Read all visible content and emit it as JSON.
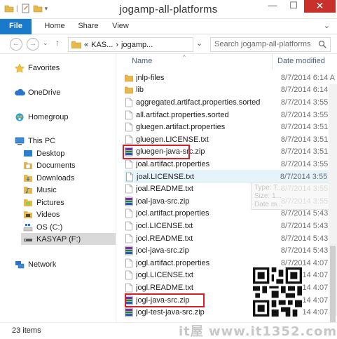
{
  "window": {
    "title": "jogamp-all-platforms",
    "minimize": "—",
    "maximize": "☐",
    "close": "✕"
  },
  "ribbon": {
    "tabs": [
      "File",
      "Home",
      "Share",
      "View"
    ],
    "expand": "⌄"
  },
  "address": {
    "back": "←",
    "forward": "→",
    "recent": "⌄",
    "up": "↑",
    "overflow": "«",
    "crumbs": [
      "KAS...",
      "jogamp..."
    ],
    "separator": "›",
    "search_placeholder": "Search jogamp-all-platforms"
  },
  "nav": {
    "favorites": "Favorites",
    "onedrive": "OneDrive",
    "homegroup": "Homegroup",
    "thispc": "This PC",
    "desktop": "Desktop",
    "documents": "Documents",
    "downloads": "Downloads",
    "music": "Music",
    "pictures": "Pictures",
    "videos": "Videos",
    "osc": "OS (C:)",
    "kasyap": "KASYAP (F:)",
    "network": "Network"
  },
  "columns": {
    "name": "Name",
    "date": "Date modified"
  },
  "files": [
    {
      "name": "jnlp-files",
      "date": "8/7/2014 6:14 A",
      "type": "folder"
    },
    {
      "name": "lib",
      "date": "8/7/2014 6:14 A",
      "type": "folder"
    },
    {
      "name": "aggregated.artifact.properties.sorted",
      "date": "8/7/2014 3:55 A",
      "type": "file"
    },
    {
      "name": "all.artifact.properties.sorted",
      "date": "8/7/2014 3:55 A",
      "type": "file"
    },
    {
      "name": "gluegen.artifact.properties",
      "date": "8/7/2014 3:51 A",
      "type": "file"
    },
    {
      "name": "gluegen.LICENSE.txt",
      "date": "8/7/2014 3:51 A",
      "type": "file"
    },
    {
      "name": "gluegen-java-src.zip",
      "date": "8/7/2014 3:51 A",
      "type": "zip"
    },
    {
      "name": "joal.artifact.properties",
      "date": "8/7/2014 3:55 A",
      "type": "file"
    },
    {
      "name": "joal.LICENSE.txt",
      "date": "8/7/2014 3:55 A",
      "type": "file"
    },
    {
      "name": "joal.README.txt",
      "date": "8/7/2014 3:55 A",
      "type": "file"
    },
    {
      "name": "joal-java-src.zip",
      "date": "8/7/2014 3:55 A",
      "type": "zip"
    },
    {
      "name": "jocl.artifact.properties",
      "date": "8/7/2014 5:43 A",
      "type": "file"
    },
    {
      "name": "jocl.LICENSE.txt",
      "date": "8/7/2014 5:43 A",
      "type": "file"
    },
    {
      "name": "jocl.README.txt",
      "date": "8/7/2014 5:43 A",
      "type": "file"
    },
    {
      "name": "jocl-java-src.zip",
      "date": "8/7/2014 5:43 A",
      "type": "zip"
    },
    {
      "name": "jogl.artifact.properties",
      "date": "8/7/2014 4:07 A",
      "type": "file"
    },
    {
      "name": "jogl.LICENSE.txt",
      "date": "8/7/2014 4:07 A",
      "type": "file"
    },
    {
      "name": "jogl.README.txt",
      "date": "8/7/2014 4:07 A",
      "type": "file"
    },
    {
      "name": "jogl-java-src.zip",
      "date": "8/7/2014 4:07 A",
      "type": "zip"
    },
    {
      "name": "jogl-test-java-src.zip",
      "date": "8/7/2014 4:07 A",
      "type": "zip"
    }
  ],
  "tooltip": {
    "line1": "Type: T...",
    "line2": "Size: 1...",
    "line3": "Date m..."
  },
  "status": {
    "count": "23 items"
  },
  "watermark": "it屋 www.it1352.com",
  "colors": {
    "accent": "#1979ca",
    "highlight_box": "#d42027",
    "folder": "#e8b84a"
  }
}
